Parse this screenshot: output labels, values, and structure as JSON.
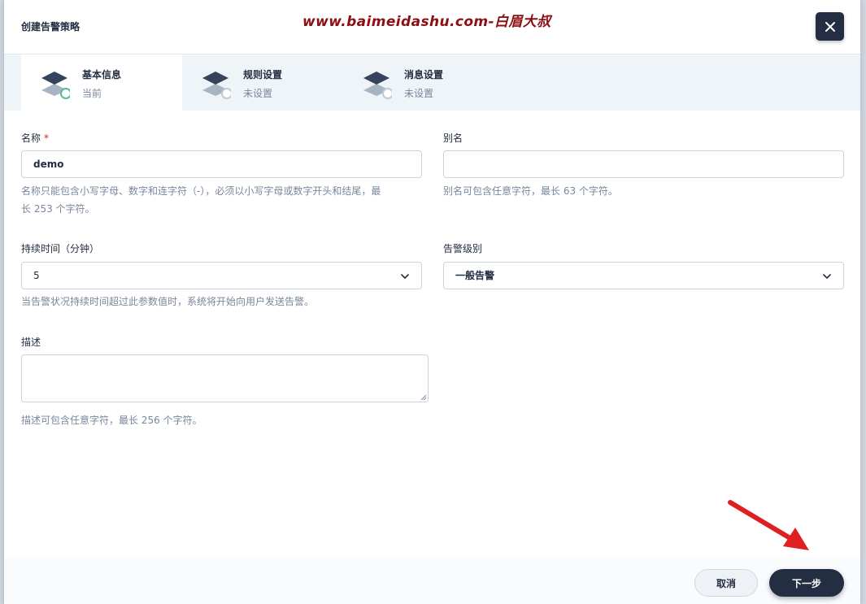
{
  "watermark": "www.baimeidashu.com-白眉大叔",
  "modal": {
    "title": "创建告警策略",
    "close_icon": "close-icon"
  },
  "steps": [
    {
      "title": "基本信息",
      "status": "当前",
      "icon": "layers-icon",
      "active": true
    },
    {
      "title": "规则设置",
      "status": "未设置",
      "icon": "layers-icon",
      "active": false
    },
    {
      "title": "消息设置",
      "status": "未设置",
      "icon": "layers-icon",
      "active": false
    }
  ],
  "form": {
    "name": {
      "label": "名称",
      "required_mark": "*",
      "value": "demo",
      "hint_line1": "名称只能包含小写字母、数字和连字符（-），必须以小写字母或数字开头和结尾，最",
      "hint_line2": "长 253 个字符。"
    },
    "alias": {
      "label": "别名",
      "value": "",
      "hint": "别名可包含任意字符，最长 63 个字符。"
    },
    "duration": {
      "label": "持续时间（分钟）",
      "value": "5",
      "hint": "当告警状况持续时间超过此参数值时，系统将开始向用户发送告警。"
    },
    "severity": {
      "label": "告警级别",
      "value": "一般告警"
    },
    "description": {
      "label": "描述",
      "value": "",
      "hint": "描述可包含任意字符，最长 256 个字符。"
    }
  },
  "footer": {
    "cancel_label": "取消",
    "next_label": "下一步"
  },
  "colors": {
    "primary_dark": "#242e42",
    "success_green": "#55bc8a",
    "annotation_red": "#e02020",
    "watermark_red": "#8c0f14"
  }
}
